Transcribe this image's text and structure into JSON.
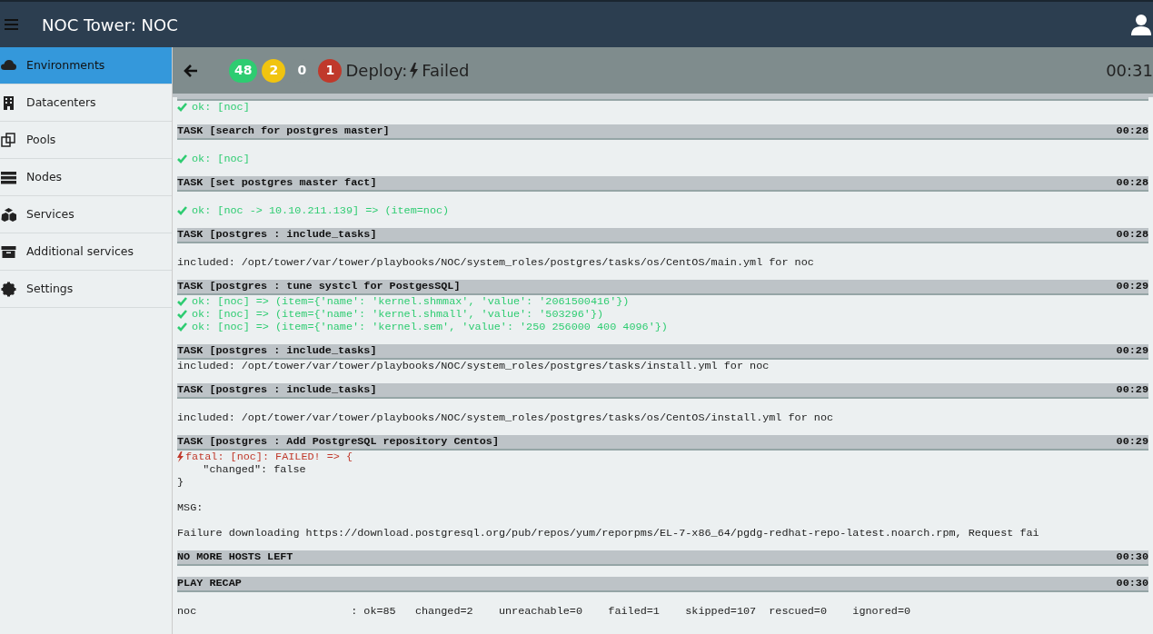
{
  "app_title": "NOC Tower: NOC",
  "sidebar": {
    "items": [
      {
        "label": "Environments",
        "selected": true
      },
      {
        "label": "Datacenters",
        "selected": false
      },
      {
        "label": "Pools",
        "selected": false
      },
      {
        "label": "Nodes",
        "selected": false
      },
      {
        "label": "Services",
        "selected": false
      },
      {
        "label": "Additional services",
        "selected": false
      },
      {
        "label": "Settings",
        "selected": false
      }
    ]
  },
  "job": {
    "counters": [
      {
        "value": "48",
        "color": "#2ecc71"
      },
      {
        "value": "2",
        "color": "#f1c40f"
      },
      {
        "value": "0",
        "color": "#7f8c8d"
      },
      {
        "value": "1",
        "color": "#c0392b"
      }
    ],
    "title_prefix": "Deploy:",
    "status": "Failed",
    "elapsed": "00:31"
  },
  "log": [
    {
      "kind": "task_partial"
    },
    {
      "kind": "ok",
      "text": "ok: [noc]"
    },
    {
      "kind": "task",
      "text": "TASK [search for postgres master]",
      "time": "00:28"
    },
    {
      "kind": "ok",
      "text": "ok: [noc]",
      "spaced": true
    },
    {
      "kind": "task",
      "text": "TASK [set postgres master fact]",
      "time": "00:28"
    },
    {
      "kind": "ok",
      "text": "ok: [noc -> 10.10.211.139] => (item=noc)",
      "spaced": true
    },
    {
      "kind": "task",
      "text": "TASK [postgres : include_tasks]",
      "time": "00:28"
    },
    {
      "kind": "text",
      "text": "included: /opt/tower/var/tower/playbooks/NOC/system_roles/postgres/tasks/os/CentOS/main.yml for noc",
      "spaced": true
    },
    {
      "kind": "task",
      "text": "TASK [postgres : tune systcl for PostgesSQL]",
      "time": "00:29"
    },
    {
      "kind": "ok",
      "text": "ok: [noc] => (item={'name': 'kernel.shmmax', 'value': '2061500416'})"
    },
    {
      "kind": "ok",
      "text": "ok: [noc] => (item={'name': 'kernel.shmall', 'value': '503296'})"
    },
    {
      "kind": "ok",
      "text": "ok: [noc] => (item={'name': 'kernel.sem', 'value': '250 256000 400 4096'})"
    },
    {
      "kind": "task",
      "text": "TASK [postgres : include_tasks]",
      "time": "00:29"
    },
    {
      "kind": "text",
      "text": "included: /opt/tower/var/tower/playbooks/NOC/system_roles/postgres/tasks/install.yml for noc"
    },
    {
      "kind": "task",
      "text": "TASK [postgres : include_tasks]",
      "time": "00:29"
    },
    {
      "kind": "text",
      "text": "included: /opt/tower/var/tower/playbooks/NOC/system_roles/postgres/tasks/os/CentOS/install.yml for noc",
      "spaced": true
    },
    {
      "kind": "task",
      "text": "TASK [postgres : Add PostgreSQL repository Centos]",
      "time": "00:29"
    },
    {
      "kind": "fatal",
      "text": "fatal: [noc]: FAILED! => {"
    },
    {
      "kind": "text",
      "text": "    \"changed\": false"
    },
    {
      "kind": "text",
      "text": "}"
    },
    {
      "kind": "text",
      "text": "MSG:",
      "spaced": true
    },
    {
      "kind": "text",
      "text": "Failure downloading https://download.postgresql.org/pub/repos/yum/reporpms/EL-7-x86_64/pgdg-redhat-repo-latest.noarch.rpm, Request fai",
      "spaced": true
    },
    {
      "kind": "task",
      "text": "NO MORE HOSTS LEFT",
      "time": "00:30"
    },
    {
      "kind": "task",
      "text": "PLAY RECAP",
      "time": "00:30"
    },
    {
      "kind": "text",
      "text": "noc                        : ok=85   changed=2    unreachable=0    failed=1    skipped=107  rescued=0    ignored=0",
      "spaced": true
    }
  ]
}
